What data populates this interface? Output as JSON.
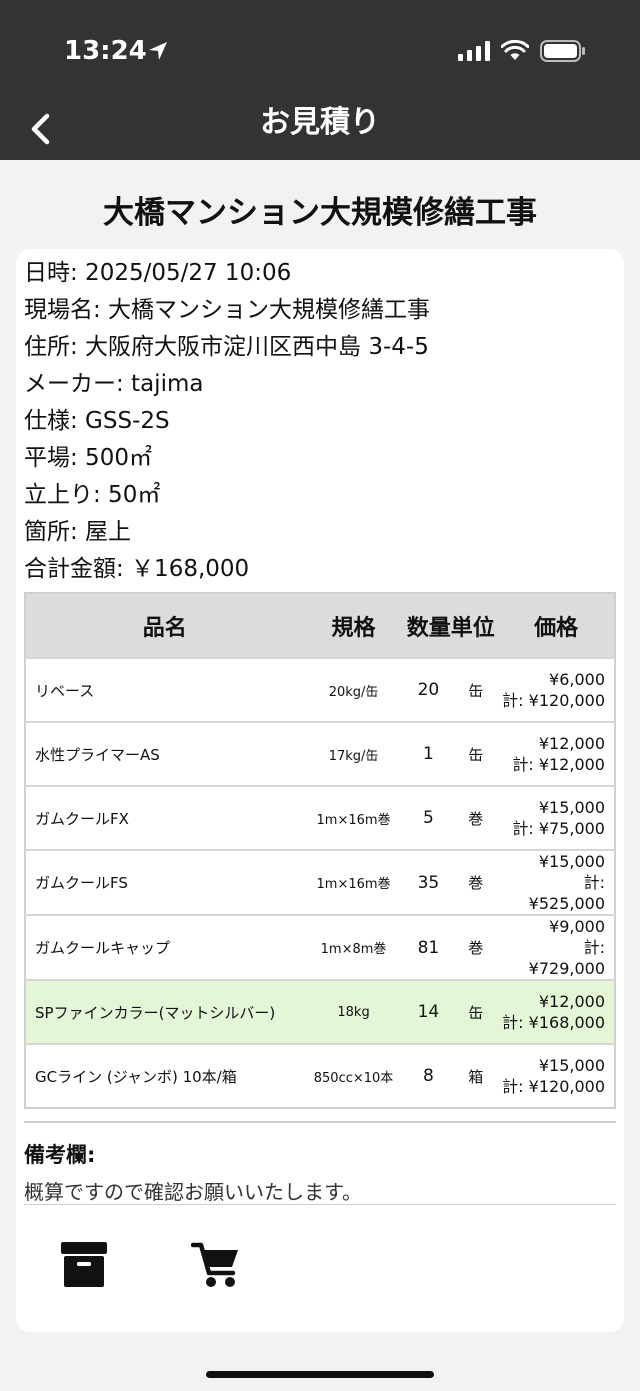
{
  "status": {
    "time": "13:24"
  },
  "nav": {
    "title": "お見積り"
  },
  "heading": "大橋マンション大規模修繕工事",
  "info": {
    "date": "日時: 2025/05/27 10:06",
    "site": "現場名: 大橋マンション大規模修繕工事",
    "address": "住所: 大阪府大阪市淀川区西中島 3-4-5",
    "maker": "メーカー: tajima",
    "spec": "仕様: GSS-2S",
    "flat": "平場: 500㎡",
    "rise": "立上り: 50㎡",
    "location": "箇所: 屋上",
    "total": "合計金額: ￥168,000"
  },
  "table": {
    "headers": {
      "name": "品名",
      "spec": "規格",
      "qty_unit": "数量単位",
      "price": "価格"
    },
    "rows": [
      {
        "name": "リベース",
        "spec": "20kg/缶",
        "qty": "20",
        "unit": "缶",
        "price": "¥6,000",
        "total": "計: ¥120,000"
      },
      {
        "name": "水性プライマーAS",
        "spec": "17kg/缶",
        "qty": "1",
        "unit": "缶",
        "price": "¥12,000",
        "total": "計: ¥12,000"
      },
      {
        "name": "ガムクールFX",
        "spec": "1m×16m巻",
        "qty": "5",
        "unit": "巻",
        "price": "¥15,000",
        "total": "計: ¥75,000"
      },
      {
        "name": "ガムクールFS",
        "spec": "1m×16m巻",
        "qty": "35",
        "unit": "巻",
        "price": "¥15,000",
        "total_a": "計:",
        "total_b": "¥525,000"
      },
      {
        "name": "ガムクールキャップ",
        "spec": "1m×8m巻",
        "qty": "81",
        "unit": "巻",
        "price": "¥9,000",
        "total_a": "計:",
        "total_b": "¥729,000"
      },
      {
        "name": "SPファインカラー(マットシルバー)",
        "spec": "18kg",
        "qty": "14",
        "unit": "缶",
        "price": "¥12,000",
        "total": "計: ¥168,000"
      },
      {
        "name": "GCライン (ジャンボ) 10本/箱",
        "spec": "850cc×10本",
        "qty": "8",
        "unit": "箱",
        "price": "¥15,000",
        "total": "計: ¥120,000"
      }
    ]
  },
  "remarks": {
    "label": "備考欄:",
    "text": "概算ですので確認お願いいたします。"
  },
  "colors": {
    "bar": "#333333",
    "highlight": "#e3f7d7",
    "header": "#dcdcdc"
  }
}
